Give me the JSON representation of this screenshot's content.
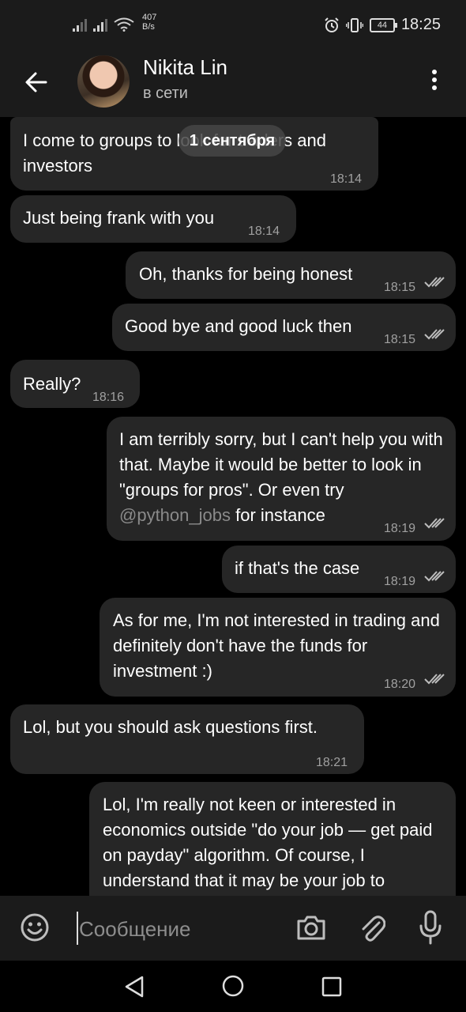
{
  "status_bar": {
    "net_speed_value": "407",
    "net_speed_unit": "B/s",
    "battery": "44",
    "time": "18:25"
  },
  "header": {
    "contact_name": "Nikita Lin",
    "contact_status": "в сети"
  },
  "date_chip": "1 сентября",
  "messages": [
    {
      "dir": "in",
      "text": "I come to groups to look for traders and investors",
      "time": "18:14"
    },
    {
      "dir": "in",
      "text": "Just being frank with you",
      "time": "18:14"
    },
    {
      "dir": "out",
      "text": "Oh, thanks for being honest",
      "time": "18:15"
    },
    {
      "dir": "out",
      "text": "Good bye and good luck then",
      "time": "18:15"
    },
    {
      "dir": "in",
      "text": "Really?",
      "time": "18:16"
    },
    {
      "dir": "out",
      "text_before": "I am terribly sorry, but I can't help you with that. Maybe it would be better to look in \"groups for pros\". Or even try",
      "mention": "@python_jobs",
      "text_after": "for instance",
      "time": "18:19"
    },
    {
      "dir": "out",
      "text": "if that's the case",
      "time": "18:19"
    },
    {
      "dir": "out",
      "text": "As for me, I'm not interested in trading and definitely don't have the funds for investment :)",
      "time": "18:20"
    },
    {
      "dir": "in",
      "text": "Lol, but you should ask questions first.",
      "time": "18:21"
    },
    {
      "dir": "out",
      "text": "Lol, I'm really not keen or interested in economics outside \"do your job — get paid on payday\" algorithm. Of course, I understand that it may be your job to",
      "time": ""
    }
  ],
  "input": {
    "placeholder": "Сообщение"
  },
  "icons": [
    "back-arrow-icon",
    "menu-dots-icon",
    "emoji-icon",
    "camera-icon",
    "attach-icon",
    "mic-icon",
    "nav-back-icon",
    "nav-home-icon",
    "nav-recents-icon",
    "signal-icon",
    "wifi-icon",
    "alarm-icon",
    "vibrate-icon",
    "battery-icon",
    "double-check-icon"
  ],
  "colors": {
    "bar_bg": "#1b1b1b",
    "chat_bg": "#000000",
    "bubble_bg": "#262626",
    "time_text": "#a0a0a0",
    "mention": "#8a8a8a"
  }
}
